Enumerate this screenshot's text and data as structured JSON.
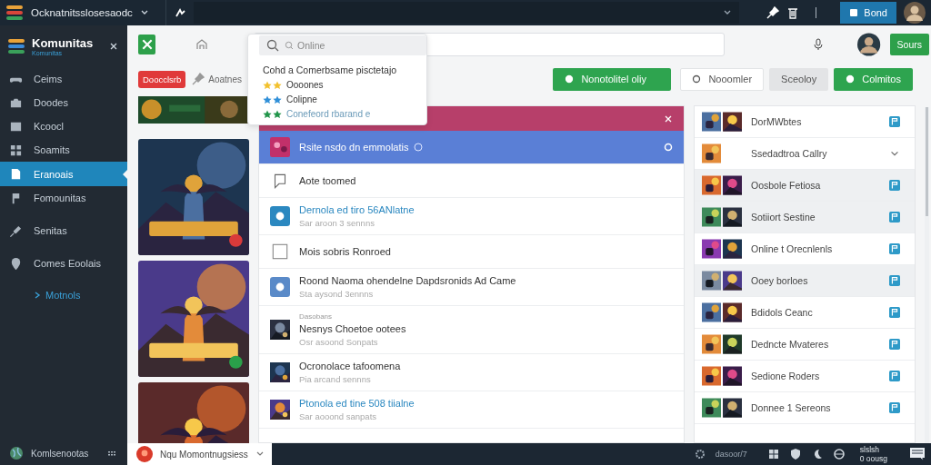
{
  "topbar": {
    "title": "Ocknatnitsslosesaodc",
    "account_button": "Bond"
  },
  "sidebar": {
    "brand": "Komunitas",
    "brand_sub": "Komunitas",
    "items": [
      {
        "label": "Ceims",
        "selected": false
      },
      {
        "label": "Doodes",
        "selected": false
      },
      {
        "label": "Kcoocl",
        "selected": false
      },
      {
        "label": "Soamits",
        "selected": false
      },
      {
        "label": "Eranoais",
        "selected": true
      },
      {
        "label": "Fomounitas",
        "selected": false
      },
      {
        "label": "Senitas",
        "selected": false
      },
      {
        "label": "Comes Eoolais",
        "selected": false
      }
    ],
    "link": "Motnols",
    "footer": "Komlsenootas"
  },
  "toolbar": {
    "button": "Sours"
  },
  "filter": {
    "tag": "Doocclsrb",
    "pin": "Aoatnes",
    "actions": [
      {
        "label": "Nonotolitel oliy",
        "kind": "primary"
      },
      {
        "label": "Nooomler",
        "kind": "outline"
      },
      {
        "label": "Sceoloy",
        "kind": "plain"
      },
      {
        "label": "Colmitos",
        "kind": "primary"
      }
    ]
  },
  "dropdown": {
    "search": {
      "placeholder": "Online"
    },
    "heading": "Cohd a Comerbsame pisctetajo",
    "items": [
      {
        "label": "Oooones",
        "color": "#f2c12e",
        "muted": false
      },
      {
        "label": "Colipne",
        "color": "#2f8fd8",
        "muted": false
      },
      {
        "label": "Conefeord rbarand e",
        "color": "#22954a",
        "muted": true
      }
    ]
  },
  "feed": {
    "rows": [
      {
        "kind": "pink",
        "title": "Rsite nsdo dn emmolatis",
        "selected": true
      },
      {
        "kind": "chat",
        "title": "Aote toomed",
        "selected": false
      },
      {
        "kind": "app",
        "title": "Dernola ed tiro 56ANlatne",
        "subtitle": "Sar aroon 3 sennns",
        "link": true,
        "selected": false
      },
      {
        "kind": "box",
        "title": "Mois sobris Ronroed",
        "selected": false
      },
      {
        "kind": "app",
        "title": "Roond Naoma ohendelne Dapdsronids Ad Came",
        "subtitle": "Sta aysond 3ennns",
        "link": false,
        "selected": false
      },
      {
        "kind": "thumb",
        "pre": "Dasobans",
        "title": "Nesnys Choetoe ootees",
        "subtitle": "Osr asoond Sonpats",
        "link": false,
        "selected": false
      },
      {
        "kind": "thumb",
        "title": "Ocronolace tafoomena",
        "subtitle": "Pia arcand sennns",
        "link": false,
        "selected": false
      },
      {
        "kind": "thumb",
        "title": "Ptonola ed tine 508 tiialne",
        "subtitle": "Sar aooond sanpats",
        "link": true,
        "selected": false
      }
    ]
  },
  "side_list": {
    "rows": [
      {
        "label": "DorMWbtes",
        "kind": "flag",
        "selected": false
      },
      {
        "label": "Ssedadtroa Callry",
        "kind": "expand",
        "selected": false
      },
      {
        "label": "Oosbole Fetiosa",
        "kind": "flag",
        "selected": true
      },
      {
        "label": "Sotiiort Sestine",
        "kind": "flag",
        "selected": true
      },
      {
        "label": "Online t Orecnlenls",
        "kind": "flag",
        "selected": false
      },
      {
        "label": "Ooey borloes",
        "kind": "flag",
        "selected": true
      },
      {
        "label": "Bdidols Ceanc",
        "kind": "flag",
        "selected": false
      },
      {
        "label": "Dedncte Mvateres",
        "kind": "flag",
        "selected": false
      },
      {
        "label": "Sedione Roders",
        "kind": "flag",
        "selected": false
      },
      {
        "label": "Donnee 1 Sereons",
        "kind": "flag",
        "selected": false
      }
    ]
  },
  "taskbar": {
    "app": "Nqu Momontnugsiess",
    "tray": "dasoor/7",
    "time": "slslsh",
    "date": "0 oousg"
  }
}
